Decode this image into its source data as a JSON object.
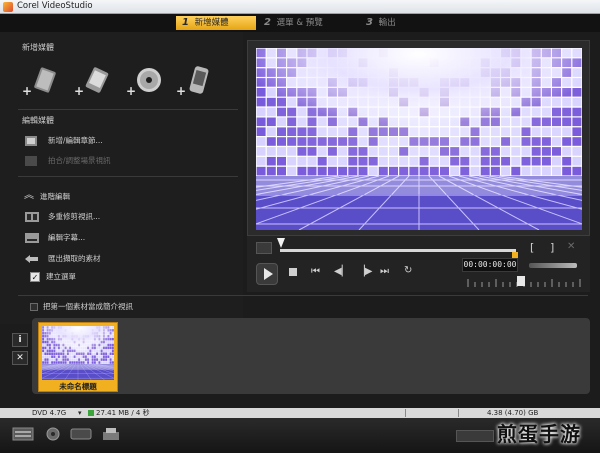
{
  "window": {
    "title": "Corel VideoStudio"
  },
  "steps": [
    {
      "num": "1",
      "label": "新增媒體"
    },
    {
      "num": "2",
      "label": "選單 & 預覽"
    },
    {
      "num": "3",
      "label": "輸出"
    }
  ],
  "left": {
    "add_media_title": "新增媒體",
    "capture_icons": [
      "video-file-icon",
      "photo-import-icon",
      "dvd-disc-icon",
      "mobile-device-icon"
    ],
    "edit_media_title": "編輯媒體",
    "edit_items": [
      {
        "label": "新增/編輯章節...",
        "enabled": true
      },
      {
        "label": "拍合/調整場景視訊",
        "enabled": false
      }
    ],
    "advanced_title": "進階編輯",
    "advanced_items": [
      {
        "label": "多重修剪視訊..."
      },
      {
        "label": "編輯字幕..."
      },
      {
        "label": "匯出擷取的素材"
      }
    ],
    "create_menu_label": "建立選單",
    "create_menu_checked": true
  },
  "player": {
    "timecode": "00:00:00:00",
    "mark_in": "[",
    "mark_out": "]"
  },
  "timeline": {
    "first_clip_option": "把第一個素材當成簡介視訊",
    "clips": [
      {
        "title": "未命名標題"
      }
    ],
    "info_button": "i",
    "remove_button": "✕"
  },
  "disc": {
    "type": "DVD 4.7G",
    "used": "27.41 MB / 4 秒",
    "capacity": "4.38 (4.70) GB"
  },
  "watermark": "煎蛋手游",
  "colors": {
    "accent": "#f0b020",
    "tab_active": "#ffd25e"
  }
}
